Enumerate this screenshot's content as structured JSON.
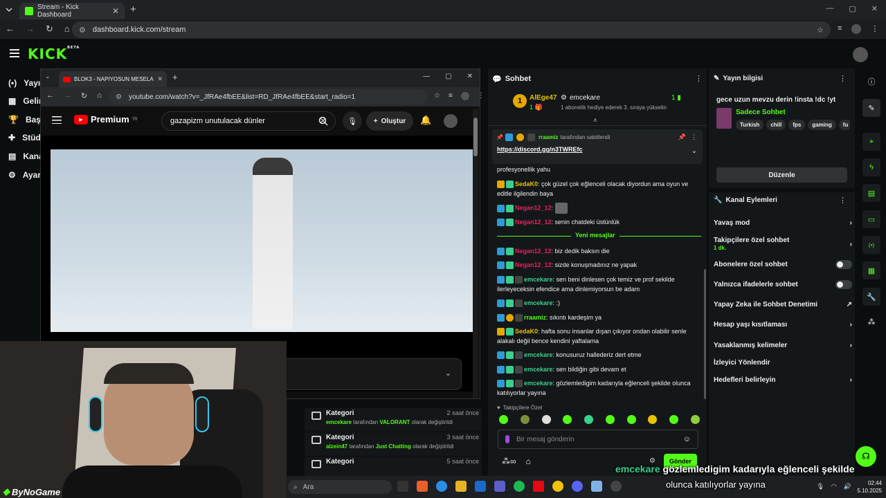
{
  "browser": {
    "tab_title": "Stream - Kick Dashboard",
    "url": "dashboard.kick.com/stream"
  },
  "kick": {
    "logo": "KICK",
    "logo_sup": "BETA",
    "nav": [
      "Yayın",
      "Gelir",
      "Başa",
      "Stüd",
      "Kana",
      "Ayar"
    ]
  },
  "youtube": {
    "tab_title": "BLOK3 - NAPIYOSUN MESELA ?",
    "url": "youtube.com/watch?v=_JfRAe4fbEE&list=RD_JfRAe4fbEE&start_radio=1",
    "logo_text": "Premium",
    "logo_sup": "TR",
    "search_value": "gazapizm unutulacak dünler",
    "create_label": "Oluştur"
  },
  "history": [
    {
      "title": "Kategori",
      "time": "2 saat önce",
      "user": "emcekare",
      "mid": " tarafından ",
      "value": "VALORANT",
      "tail": " olarak değiştirildi",
      "value_color": "#53fc18"
    },
    {
      "title": "Kategori",
      "time": "3 saat önce",
      "user": "alzein47",
      "mid": " tarafından ",
      "value": "Just Chatting",
      "tail": " olarak değiştirildi",
      "value_color": "#53fc18"
    },
    {
      "title": "Kategori",
      "time": "5 saat önce",
      "user": "",
      "mid": "",
      "value": "",
      "tail": "",
      "value_color": "#53fc18"
    }
  ],
  "chat": {
    "title": "Sohbet",
    "top_gifter": {
      "name": "AlEge47",
      "rank": "1",
      "count": "1"
    },
    "sub_event": {
      "name": "emcekare",
      "count": "1",
      "text": "1 abonelik hediye ederek 3. sıraya yükselin"
    },
    "pinned": {
      "by": "rraamiz",
      "by_text": "tarafından sabitlendi",
      "link": "https://discord.gg/n3TWREfc"
    },
    "new_messages_label": "Yeni mesajlar",
    "followers_only": "Takipçilere Özel",
    "input_placeholder": "Bir mesaj gönderin",
    "send_label": "Gönder",
    "messages": [
      {
        "user": "",
        "color": "#eee",
        "text": "profesyonellik yahu"
      },
      {
        "user": "SedaK0",
        "color": "#e6c200",
        "text": ": çok güzel çok eğlenceli olacak diyordun ama oyun ve editle ilgilendin baya"
      },
      {
        "user": "Negan12_12",
        "color": "#e0245e",
        "text": ":"
      },
      {
        "user": "Negan12_12",
        "color": "#e0245e",
        "text": ": senin chatdeki üstünlük"
      },
      {
        "user": "Negan12_12",
        "color": "#e0245e",
        "text": ": biz dedik baksın die"
      },
      {
        "user": "Negan12_12",
        "color": "#e0245e",
        "text": ": sizde konuşmadınız ne yapak"
      },
      {
        "user": "emcekare",
        "color": "#3bcf8d",
        "text": ": sen beni dinlesen çok temiz ve prof sekilde ilerleyeceksin efendice ama dinlemiyorsun be adam"
      },
      {
        "user": "emcekare",
        "color": "#3bcf8d",
        "text": ": :)"
      },
      {
        "user": "rraamiz",
        "color": "#53fc18",
        "text": ": sıkıntı kardeşim ya"
      },
      {
        "user": "SedaK0",
        "color": "#e6c200",
        "text": ": hafta sonu insanlar dışan çıkıyor ondan olabilir senle alakalı değil bence kendini yaftalama"
      },
      {
        "user": "emcekare",
        "color": "#3bcf8d",
        "text": ": konusuruz hallederiz dert etme"
      },
      {
        "user": "emcekare",
        "color": "#3bcf8d",
        "text": ": sen bildiğin gibi devam et"
      },
      {
        "user": "emcekare",
        "color": "#3bcf8d",
        "text": ": gözlemledigim kadarıyla eğlenceli şekilde olunca katılıyorlar yayına"
      }
    ]
  },
  "stream_info": {
    "title": "Yayın bilgisi",
    "stream_title": "gece uzun mevzu derin !insta !dc !yt",
    "category": "Sadece Sohbet",
    "tags": [
      "Turkish",
      "chill",
      "fps",
      "gaming",
      "fu"
    ],
    "edit_label": "Düzenle"
  },
  "channel_actions": {
    "title": "Kanal Eylemleri",
    "items": [
      {
        "label": "Yavaş mod",
        "sub": "",
        "control": "chevron"
      },
      {
        "label": "Takipçilere özel sohbet",
        "sub": "1 dk.",
        "control": "chevron"
      },
      {
        "label": "Abonelere özel sohbet",
        "sub": "",
        "control": "toggle"
      },
      {
        "label": "Yalnızca ifadelerle sohbet",
        "sub": "",
        "control": "toggle"
      },
      {
        "label": "Yapay Zeka ile Sohbet Denetimi",
        "sub": "",
        "control": "external"
      },
      {
        "label": "Hesap yaşı kısıtlaması",
        "sub": "",
        "control": "chevron"
      },
      {
        "label": "Yasaklanmış kelimeler",
        "sub": "",
        "control": "chevron"
      },
      {
        "label": "İzleyici Yönlendir",
        "sub": "",
        "control": "none"
      },
      {
        "label": "Hedefleri belirleyin",
        "sub": "",
        "control": "chevron"
      }
    ]
  },
  "overlay": {
    "user": "emcekare",
    "line1": "gözlemledigim kadarıyla eğlenceli şekilde",
    "line2": "olunca katılıyorlar yayına",
    "watermark": "ByNoGame"
  },
  "taskbar": {
    "search_placeholder": "Ara",
    "time": "02:44",
    "date": "5.10.2025"
  },
  "colors": {
    "kick_green": "#53fc18",
    "chat_bg": "#141719"
  }
}
